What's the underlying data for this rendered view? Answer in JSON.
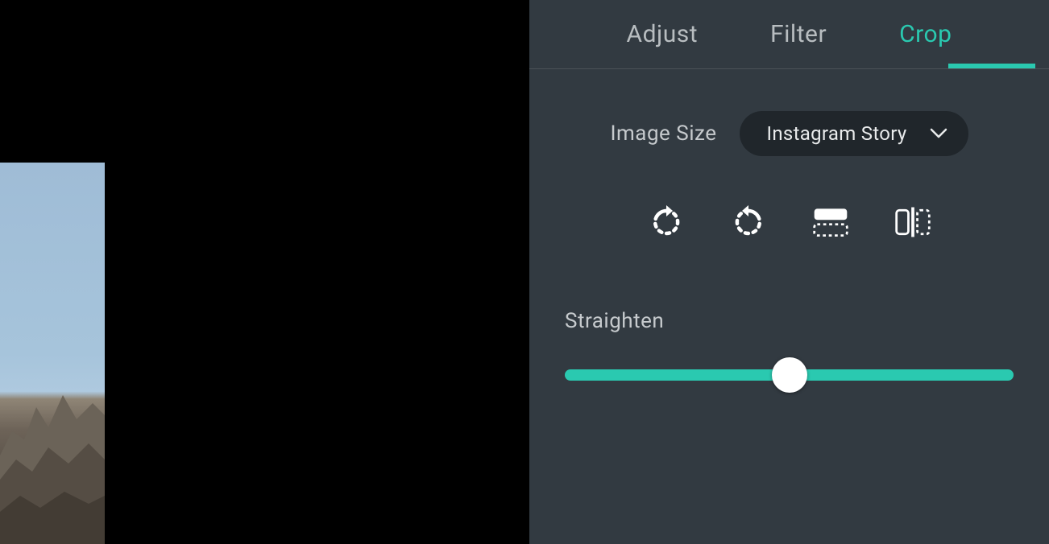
{
  "tabs": {
    "adjust": "Adjust",
    "filter": "Filter",
    "crop": "Crop",
    "active": "crop"
  },
  "crop_panel": {
    "size_label": "Image Size",
    "size_value": "Instagram Story",
    "straighten_label": "Straighten",
    "straighten_value": 0
  },
  "icons": {
    "rotate_left": "rotate-left-icon",
    "rotate_right": "rotate-right-icon",
    "flip_horizontal": "flip-horizontal-icon",
    "flip_vertical": "flip-vertical-icon",
    "chevron_down": "chevron-down-icon"
  },
  "colors": {
    "accent": "#2ac9b0",
    "panel_bg": "#323a41",
    "dropdown_bg": "#20262b"
  }
}
